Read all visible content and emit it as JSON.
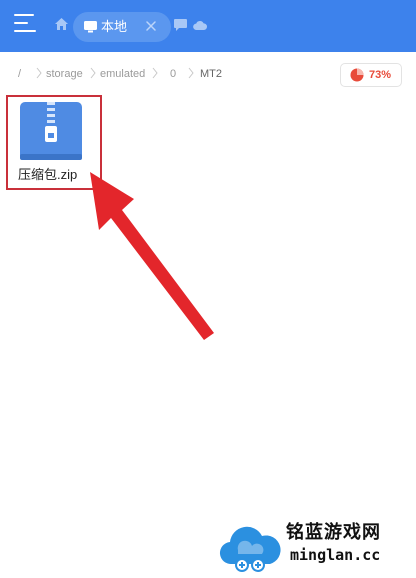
{
  "header": {
    "tab_label": "本地",
    "colors": {
      "bar": "#3d82ec",
      "tab": "#5b97ef"
    }
  },
  "breadcrumb": {
    "items": [
      "/",
      "storage",
      "emulated",
      "0",
      "MT2"
    ]
  },
  "storage": {
    "usage": "73%",
    "color": "#e84b3a"
  },
  "files": [
    {
      "name": "压缩包.zip",
      "type": "zip-archive-icon"
    }
  ],
  "watermark": {
    "title": "铭蓝游戏网",
    "url": "minglan.cc"
  }
}
